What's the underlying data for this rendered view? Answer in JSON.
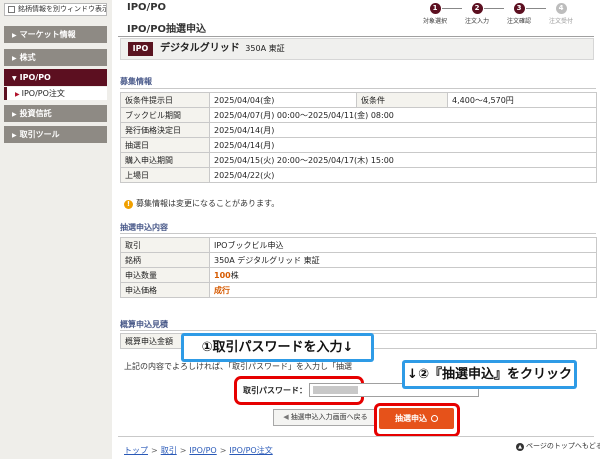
{
  "sidebar": {
    "stock_window_button": "銘柄情報を別ウィンドウ表示",
    "items": [
      {
        "label": "マーケット情報",
        "expanded": false
      },
      {
        "label": "株式",
        "expanded": false
      },
      {
        "label": "IPO/PO",
        "expanded": true
      },
      {
        "label": "投資信託",
        "expanded": false
      },
      {
        "label": "取引ツール",
        "expanded": false
      }
    ],
    "sub_item": "IPO/PO注文"
  },
  "header": {
    "section": "IPO/PO",
    "title": "IPO/PO抽選申込"
  },
  "steps": [
    {
      "num": "1",
      "label": "対象選択",
      "state": "done"
    },
    {
      "num": "2",
      "label": "注文入力",
      "state": "done"
    },
    {
      "num": "3",
      "label": "注文確認",
      "state": "current"
    },
    {
      "num": "4",
      "label": "注文受付",
      "state": "inactive"
    }
  ],
  "stock": {
    "badge": "IPO",
    "name": "デジタルグリッド",
    "code": "350A 東証"
  },
  "recruit": {
    "title": "募集情報",
    "rows": [
      {
        "label": "仮条件提示日",
        "value": "2025/04/04(金)"
      },
      {
        "label": "ブックビル期間",
        "value": "2025/04/07(月) 00:00～2025/04/11(金) 08:00"
      },
      {
        "label": "発行価格決定日",
        "value": "2025/04/14(月)"
      },
      {
        "label": "抽選日",
        "value": "2025/04/14(月)"
      },
      {
        "label": "購入申込期間",
        "value": "2025/04/15(火) 20:00～2025/04/17(木) 15:00"
      },
      {
        "label": "上場日",
        "value": "2025/04/22(火)"
      }
    ],
    "extra_label": "仮条件",
    "extra_value": "4,400～4,570円",
    "note": "募集情報は変更になることがあります。"
  },
  "lottery": {
    "title": "抽選申込内容",
    "rows": [
      {
        "label": "取引",
        "value": "IPOブックビル申込"
      },
      {
        "label": "銘柄",
        "value": "350A デジタルグリッド 東証"
      }
    ],
    "qty_label": "申込数量",
    "qty_number": "100",
    "qty_unit": "株",
    "price_label": "申込価格",
    "price_value": "成行"
  },
  "estimate": {
    "title": "概算申込見積",
    "amount_label": "概算申込金額"
  },
  "confirm_text": "上記の内容でよろしければ、「取引パスワード」を入力し「抽選",
  "password": {
    "label": "取引パスワード："
  },
  "buttons": {
    "back": "抽選申込入力画面へ戻る",
    "submit": "抽選申込"
  },
  "callouts": {
    "step1": "①取引パスワードを入力↓",
    "step2": "↓②『抽選申込』をクリック"
  },
  "footer": {
    "crumbs": [
      "トップ",
      "取引",
      "IPO/PO",
      "IPO/PO注文"
    ],
    "page_top": "ページのトップへもどる"
  },
  "colors": {
    "brand": "#5c0f20",
    "submit": "#e6521a",
    "highlight": "#e60000",
    "callout": "#2e9be6",
    "accent_text": "#d65a00"
  }
}
